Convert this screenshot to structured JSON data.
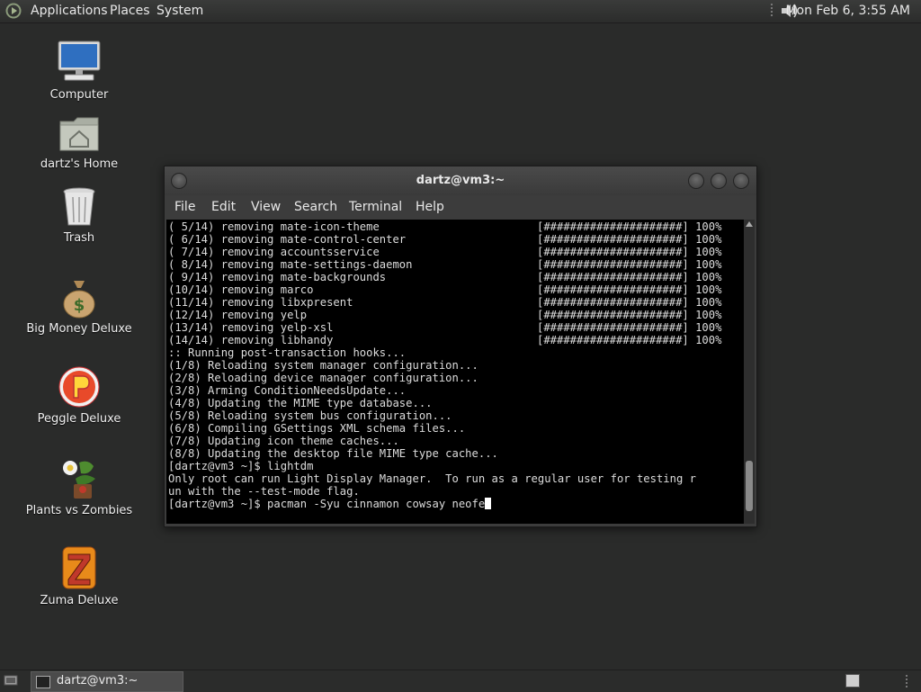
{
  "top_panel": {
    "menus": [
      "Applications",
      "Places",
      "System"
    ],
    "clock": "Mon Feb  6, 3:55 AM"
  },
  "desktop_icons": [
    {
      "label": "Computer",
      "icon": "computer-icon"
    },
    {
      "label": "dartz's Home",
      "icon": "home-folder-icon"
    },
    {
      "label": "Trash",
      "icon": "trash-icon"
    },
    {
      "label": "Big Money Deluxe",
      "icon": "money-bag-icon"
    },
    {
      "label": "Peggle Deluxe",
      "icon": "peggle-icon"
    },
    {
      "label": "Plants vs Zombies",
      "icon": "plants-vs-zombies-icon"
    },
    {
      "label": "Zuma Deluxe",
      "icon": "zuma-icon"
    }
  ],
  "terminal": {
    "title": "dartz@vm3:~",
    "menu": [
      "File",
      "Edit",
      "View",
      "Search",
      "Terminal",
      "Help"
    ],
    "lines": [
      {
        "text": "( 5/14) removing mate-icon-theme",
        "progress": "[#####################] 100%"
      },
      {
        "text": "( 6/14) removing mate-control-center",
        "progress": "[#####################] 100%"
      },
      {
        "text": "( 7/14) removing accountsservice",
        "progress": "[#####################] 100%"
      },
      {
        "text": "( 8/14) removing mate-settings-daemon",
        "progress": "[#####################] 100%"
      },
      {
        "text": "( 9/14) removing mate-backgrounds",
        "progress": "[#####################] 100%"
      },
      {
        "text": "(10/14) removing marco",
        "progress": "[#####################] 100%"
      },
      {
        "text": "(11/14) removing libxpresent",
        "progress": "[#####################] 100%"
      },
      {
        "text": "(12/14) removing yelp",
        "progress": "[#####################] 100%"
      },
      {
        "text": "(13/14) removing yelp-xsl",
        "progress": "[#####################] 100%"
      },
      {
        "text": "(14/14) removing libhandy",
        "progress": "[#####################] 100%"
      },
      {
        "text": ":: Running post-transaction hooks...",
        "progress": ""
      },
      {
        "text": "(1/8) Reloading system manager configuration...",
        "progress": ""
      },
      {
        "text": "(2/8) Reloading device manager configuration...",
        "progress": ""
      },
      {
        "text": "(3/8) Arming ConditionNeedsUpdate...",
        "progress": ""
      },
      {
        "text": "(4/8) Updating the MIME type database...",
        "progress": ""
      },
      {
        "text": "(5/8) Reloading system bus configuration...",
        "progress": ""
      },
      {
        "text": "(6/8) Compiling GSettings XML schema files...",
        "progress": ""
      },
      {
        "text": "(7/8) Updating icon theme caches...",
        "progress": ""
      },
      {
        "text": "(8/8) Updating the desktop file MIME type cache...",
        "progress": ""
      },
      {
        "text": "[dartz@vm3 ~]$ lightdm",
        "progress": ""
      },
      {
        "text": "Only root can run Light Display Manager.  To run as a regular user for testing r",
        "progress": ""
      },
      {
        "text": "un with the --test-mode flag.",
        "progress": ""
      }
    ],
    "prompt_line": "[dartz@vm3 ~]$ pacman -Syu cinnamon cowsay neofe"
  },
  "bottom_panel": {
    "task_label": "dartz@vm3:~"
  },
  "colors": {
    "desktop_bg": "#2a2b2a",
    "terminal_bg": "#000000",
    "terminal_fg": "#dcdcdc"
  }
}
